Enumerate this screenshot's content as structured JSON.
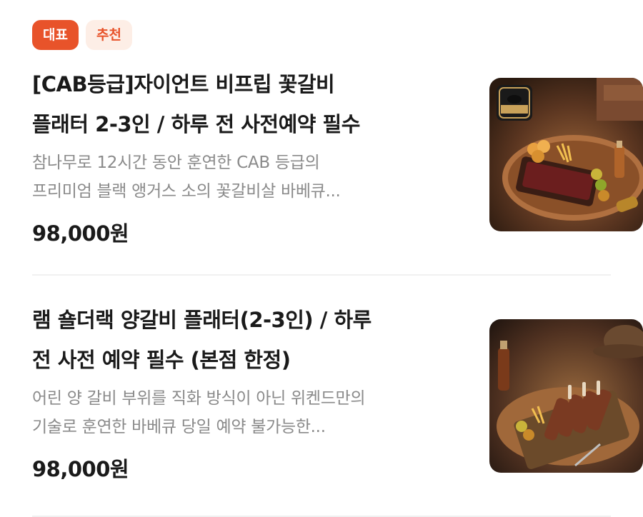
{
  "items": [
    {
      "badges": {
        "main": "대표",
        "recommend": "추천"
      },
      "title_line1": "[CAB등급]자이언트 비프립 꽃갈비",
      "title_line2": "플래터 2-3인 / 하루 전 사전예약 필수",
      "desc_line1": "참나무로 12시간 동안 훈연한 CAB 등급의",
      "desc_line2": "프리미엄 블랙 앵거스 소의 꽃갈비살 바베큐...",
      "price": "98,000원",
      "image_alt": "beef rib platter photo"
    },
    {
      "title_line1": "램 숄더랙 양갈비 플래터(2-3인) / 하루",
      "title_line2": "전 사전 예약 필수 (본점 한정)",
      "desc_line1": "어린 양 갈비 부위를 직화 방식이 아닌 위켄드만의",
      "desc_line2": "기술로 훈연한 바베큐 당일 예약 불가능한...",
      "price": "98,000원",
      "image_alt": "lamb rack platter photo"
    }
  ],
  "colors": {
    "accent": "#e8532a",
    "accent_soft": "#fdeee6",
    "muted": "#8a8a8a"
  }
}
